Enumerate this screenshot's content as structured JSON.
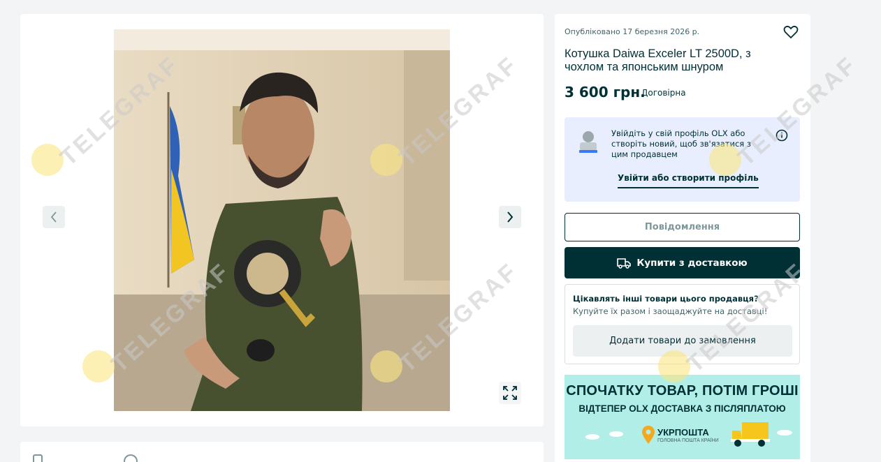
{
  "listing": {
    "published": "Опубліковано 17 березня 2026 р.",
    "title": "Котушка Daiwa Exceler LT 2500D, з чохлом та японським шнуром",
    "price": "3 600 грн.",
    "negotiable": "Договірна"
  },
  "login_prompt": {
    "text": "Увійдіть у свій профіль OLX або створіть новий, щоб зв'язатися з цим продавцем",
    "link": "Увійти або створити профіль"
  },
  "buttons": {
    "message": "Повідомлення",
    "buy": "Купити з доставкою",
    "add_items": "Додати товари до замовлення"
  },
  "bundle": {
    "bold": "Цікавлять інші товари цього продавця?",
    "rest": " Купуйте їх разом і заощаджуйте на доставці!"
  },
  "banner": {
    "line1": "СПОЧАТКУ ТОВАР, ПОТІМ ГРОШІ",
    "line2": "ВІДТЕПЕР OLX ДОСТАВКА З ПІСЛЯПЛАТОЮ",
    "brand": "УКРПОШТА",
    "brand_sub": "ГОЛОВНА ПОШТА КРАЇНИ"
  },
  "watermark": "TELEGRAF",
  "icons": [
    "chevron-left-icon",
    "chevron-right-icon",
    "expand-icon",
    "heart-icon",
    "info-icon",
    "truck-icon",
    "user-avatar-icon"
  ],
  "colors": {
    "primary": "#002f34",
    "banner_bg": "#b2eee8",
    "login_bg": "#e8eefd",
    "page_bg": "#f2f4f5"
  }
}
